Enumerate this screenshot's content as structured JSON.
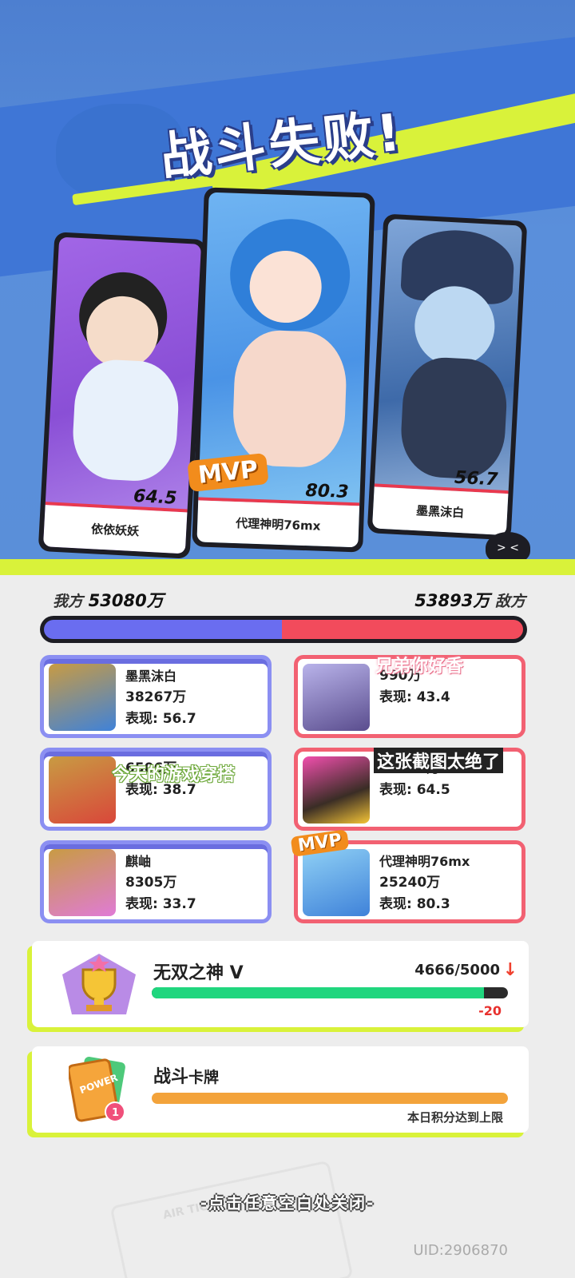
{
  "banner": {
    "title": "战斗失败!",
    "cards": [
      {
        "name": "依依妖妖",
        "score": "64.5"
      },
      {
        "name": "代理神明76mx",
        "score": "80.3",
        "mvp": "MVP"
      },
      {
        "name": "墨黑沫白",
        "score": "56.7"
      }
    ],
    "emote": "> <"
  },
  "teams": {
    "ours_label": "我方",
    "ours_total": "53080万",
    "enemy_label": "敌方",
    "enemy_total": "53893万",
    "ours_share": 0.496
  },
  "players": {
    "left": [
      {
        "name": "墨黑沫白",
        "amount": "38267万",
        "perf": "表现: 56.7"
      },
      {
        "name": "",
        "amount": "6506万",
        "perf": "表现: 38.7"
      },
      {
        "name": "麒岫",
        "amount": "8305万",
        "perf": "表现: 33.7"
      }
    ],
    "right": [
      {
        "name": "",
        "amount": "990万",
        "perf": "表现: 43.4"
      },
      {
        "name": "",
        "amount": "27663万",
        "perf": "表现: 64.5"
      },
      {
        "name": "代理神明76mx",
        "amount": "25240万",
        "perf": "表现: 80.3",
        "mvp": "MVP"
      }
    ]
  },
  "overlays": {
    "bullet1": "兄弟你好香",
    "bullet2": "今天的游戏穿搭",
    "bullet3": "这张截图太绝了"
  },
  "rank": {
    "title": "无双之神 V",
    "score": "4666/5000",
    "progress": 0.933,
    "arrow": "↓",
    "delta": "-20"
  },
  "battle_cards": {
    "title": "战斗",
    "title_sub": "卡牌",
    "progress": 1.0,
    "note": "本日积分达到上限",
    "badge": "1",
    "card_label": "POWER"
  },
  "footer": {
    "close_hint": "-点击任意空白处关闭-",
    "uid": "UID:2906870",
    "ticket_text": "AIR TICKET"
  },
  "colors": {
    "our_team": "#6a6df0",
    "enemy_team": "#f24b5c",
    "rank_fill": "#20d67e",
    "card_fill": "#f3a33b",
    "mvp": "#f28c1c",
    "accent_lime": "#d9f23a"
  }
}
